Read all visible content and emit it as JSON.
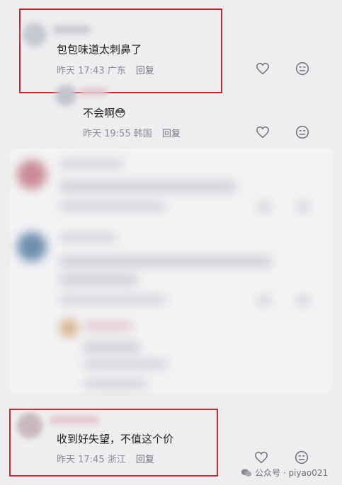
{
  "comments": [
    {
      "text": "包包味道太刺鼻了",
      "time": "昨天 17:43",
      "location": "广东",
      "reply_label": "回复"
    },
    {
      "text": "不会啊😳",
      "time": "昨天 19:55",
      "location": "韩国",
      "reply_label": "回复"
    },
    {
      "text": "收到好失望，不值这个价",
      "time": "昨天 17:45",
      "location": "浙江",
      "reply_label": "回复"
    }
  ],
  "icons": {
    "like": "heart-icon",
    "dislike": "neutral-face-icon"
  },
  "watermark": {
    "text": "公众号 · piyao021"
  },
  "colors": {
    "background": "#eeeef0",
    "highlight_border": "#c8282e",
    "meta_text": "#8a8d94"
  }
}
